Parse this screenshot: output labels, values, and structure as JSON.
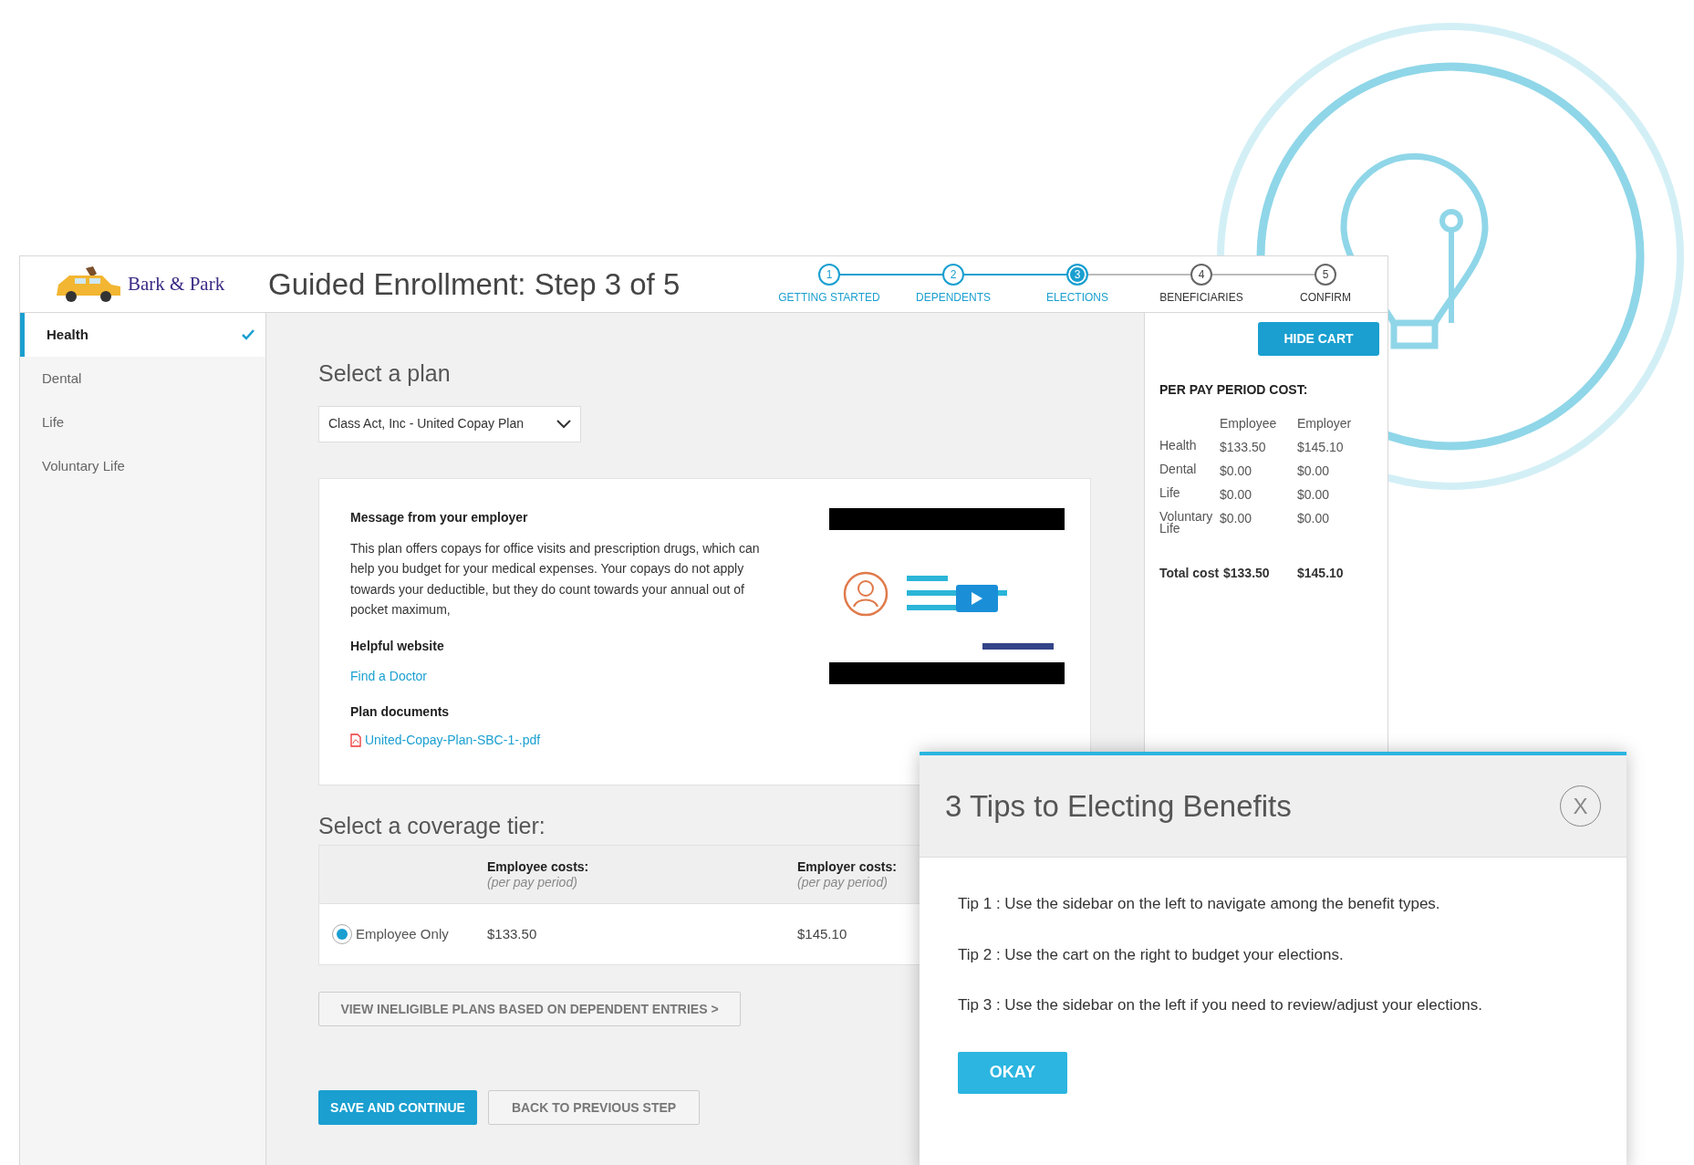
{
  "header": {
    "logo_text": "Bark & Park",
    "title": "Guided Enrollment: Step 3 of 5",
    "steps": [
      {
        "number": "1",
        "label": "GETTING STARTED",
        "completed": true,
        "selected": false
      },
      {
        "number": "2",
        "label": "DEPENDENTS",
        "completed": true,
        "selected": false
      },
      {
        "number": "3",
        "label": "ELECTIONS",
        "completed": true,
        "selected": true
      },
      {
        "number": "4",
        "label": "BENEFICIARIES",
        "completed": false,
        "selected": false
      },
      {
        "number": "5",
        "label": "CONFIRM",
        "completed": false,
        "selected": false
      }
    ]
  },
  "sidebar": {
    "items": [
      {
        "label": "Health",
        "selected": true,
        "checked": true
      },
      {
        "label": "Dental",
        "selected": false,
        "checked": false
      },
      {
        "label": "Life",
        "selected": false,
        "checked": false
      },
      {
        "label": "Voluntary Life",
        "selected": false,
        "checked": false
      }
    ]
  },
  "plan": {
    "heading": "Select a plan",
    "dropdown_value": "Class Act, Inc - United Copay Plan",
    "message_title": "Message from your employer",
    "message": "This plan offers copays for office visits and prescription drugs, which can help you budget for your medical expenses. Your copays do not apply towards your deductible, but they do count towards your annual out of pocket maximum,",
    "website_title": "Helpful website",
    "website_link": "Find a Doctor",
    "documents_title": "Plan documents",
    "document_link": "United-Copay-Plan-SBC-1-.pdf"
  },
  "coverage": {
    "heading": "Select a coverage tier:",
    "columns": [
      {
        "title": "Employee costs:",
        "subtitle": "(per pay period)"
      },
      {
        "title": "Employer costs:",
        "subtitle": "(per pay period)"
      }
    ],
    "rows": [
      {
        "label": "Employee Only",
        "selected": true,
        "employee": "$133.50",
        "employer": "$145.10"
      }
    ]
  },
  "ineligible_button": "VIEW INELIGIBLE PLANS BASED ON DEPENDENT ENTRIES >",
  "actions": [
    "SAVE AND CONTINUE",
    "BACK TO PREVIOUS STEP"
  ],
  "cart": {
    "button": "HIDE CART",
    "title": "PER PAY PERIOD COST:",
    "columns": [
      "Employee",
      "Employer"
    ],
    "rows": [
      {
        "label": "Health",
        "employee": "$133.50",
        "employer": "$145.10"
      },
      {
        "label": "Dental",
        "employee": "$0.00",
        "employer": "$0.00"
      },
      {
        "label": "Life",
        "employee": "$0.00",
        "employer": "$0.00"
      },
      {
        "label": "Voluntary Life",
        "employee": "$0.00",
        "employer": "$0.00"
      }
    ],
    "total": {
      "label": "Total cost",
      "employee": "$133.50",
      "employer": "$145.10"
    }
  },
  "dialog": {
    "title": "3 Tips to Electing Benefits",
    "close": "X",
    "tips": [
      "Tip 1 : Use the sidebar on the left to navigate among the benefit types.",
      "Tip 2 : Use the cart on the right to budget your elections.",
      "Tip 3 : Use the sidebar on the left if you need to review/adjust your elections."
    ],
    "button": "OKAY"
  }
}
